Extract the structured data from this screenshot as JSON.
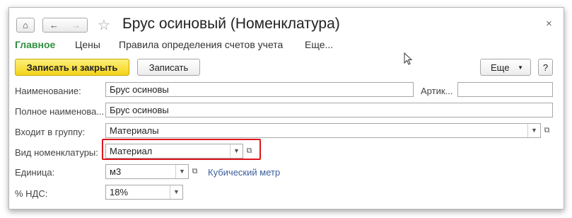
{
  "header": {
    "title": "Брус осиновый (Номенклатура)",
    "home_icon": "home-icon",
    "back_icon": "arrow-left-icon",
    "forward_icon": "arrow-right-icon",
    "star_icon": "star-icon",
    "close_icon": "close-icon"
  },
  "tabs": [
    {
      "label": "Главное",
      "active": true
    },
    {
      "label": "Цены"
    },
    {
      "label": "Правила определения счетов учета"
    },
    {
      "label": "Еще..."
    }
  ],
  "toolbar": {
    "save_close_label": "Записать и закрыть",
    "save_label": "Записать",
    "more_label": "Еще",
    "help_label": "?"
  },
  "form": {
    "name": {
      "label": "Наименование:",
      "value": "Брус осиновы"
    },
    "article": {
      "label": "Артик...",
      "value": ""
    },
    "full_name": {
      "label": "Полное наименова...",
      "value": "Брус осиновы"
    },
    "group": {
      "label": "Входит в группу:",
      "value": "Материалы"
    },
    "kind": {
      "label": "Вид номенклатуры:",
      "value": "Материал"
    },
    "unit": {
      "label": "Единица:",
      "value": "м3",
      "link": "Кубический метр"
    },
    "vat": {
      "label": "% НДС:",
      "value": "18%"
    }
  },
  "colors": {
    "accent_green": "#2f8f3f",
    "primary_button": "#f3d21a",
    "highlight_red": "#e0141b",
    "link_blue": "#3a5f9e"
  }
}
